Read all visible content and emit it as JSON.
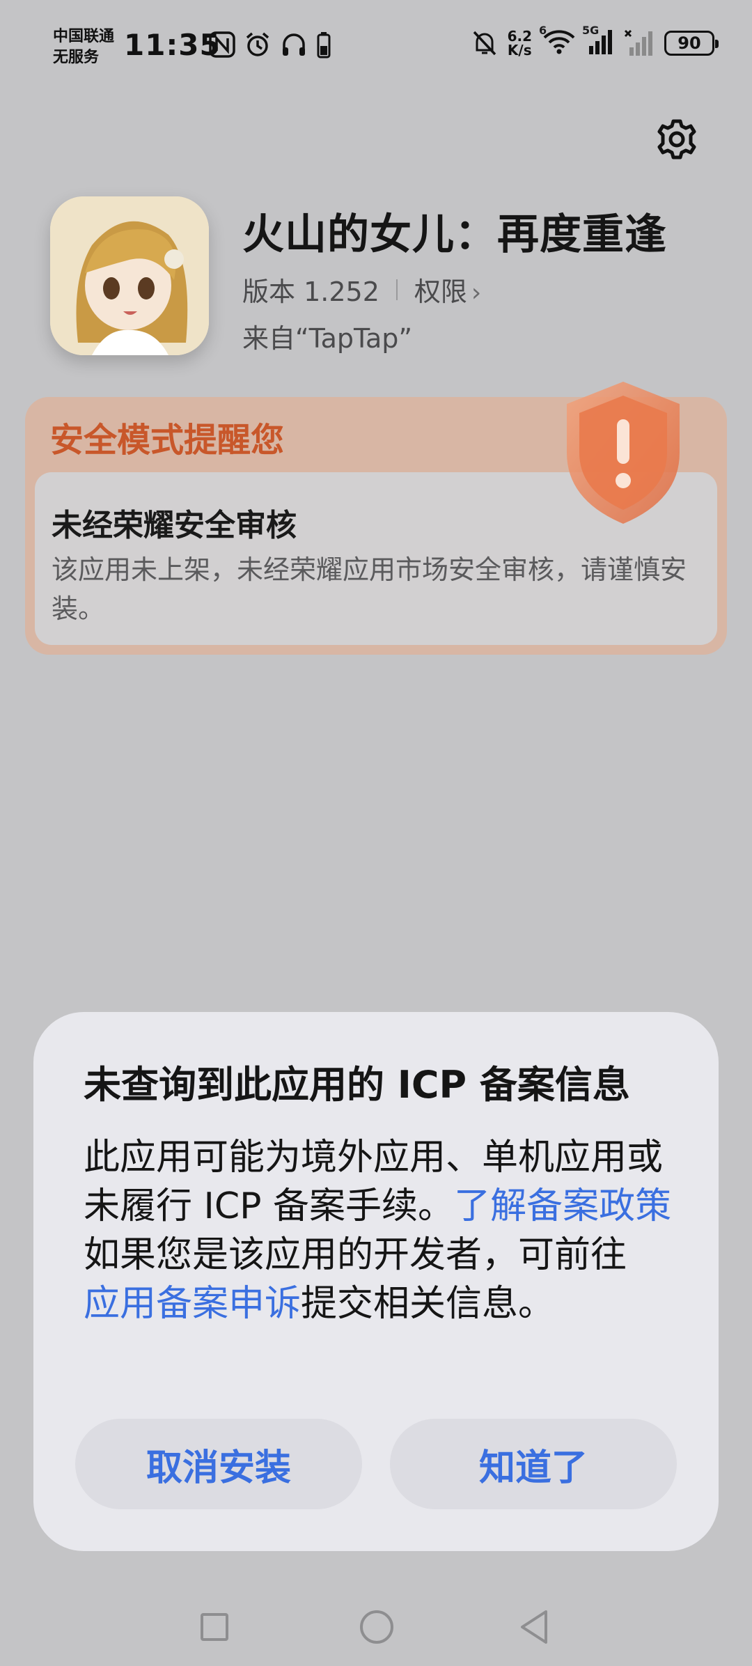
{
  "status_bar": {
    "carrier_line1": "中国联通",
    "carrier_line2": "无服务",
    "time": "11:35",
    "net_speed_value": "6.2",
    "net_speed_unit": "K/s",
    "wifi_label": "6",
    "signal_label": "5G",
    "battery": "90"
  },
  "app": {
    "title": "火山的女儿：再度重逢",
    "version": "版本 1.252",
    "permissions_label": "权限",
    "source": "来自“TapTap”"
  },
  "warning": {
    "header": "安全模式提醒您",
    "subtitle": "未经荣耀安全审核",
    "body": "该应用未上架，未经荣耀应用市场安全审核，请谨慎安装。"
  },
  "dialog": {
    "title": "未查询到此应用的 ICP 备案信息",
    "body_part1": "此应用可能为境外应用、单机应用或未履行 ICP 备案手续。",
    "link_policy": "了解备案政策",
    "body_part2": "如果您是该应用的开发者，可前往",
    "link_appeal": "应用备案申诉",
    "body_part3": "提交相关信息。",
    "cancel_button": "取消安装",
    "ok_button": "知道了"
  },
  "colors": {
    "accent_blue": "#3a6fe0",
    "warning_orange": "#c8572a"
  },
  "icons": [
    "nfc-icon",
    "alarm-icon",
    "headphones-icon",
    "battery-small-icon",
    "mute-icon",
    "wifi-icon",
    "signal-icon",
    "gear-icon",
    "shield-warning-icon",
    "nav-recents-icon",
    "nav-home-icon",
    "nav-back-icon"
  ]
}
